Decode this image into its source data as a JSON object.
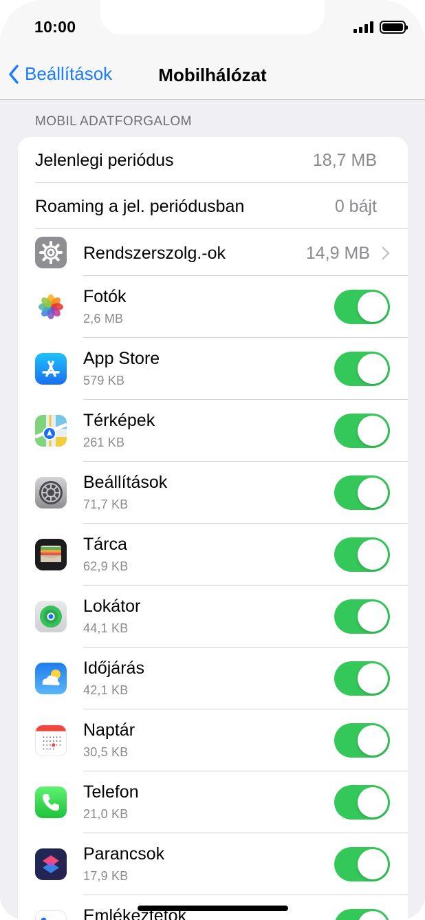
{
  "status_bar": {
    "time": "10:00"
  },
  "nav": {
    "back_label": "Beállítások",
    "title": "Mobilhálózat"
  },
  "section_header": "MOBIL ADATFORGALOM",
  "summary_rows": [
    {
      "label": "Jelenlegi periódus",
      "value": "18,7 MB"
    },
    {
      "label": "Roaming a jel. periódusban",
      "value": "0 bájt"
    }
  ],
  "system_services": {
    "label": "Rendszerszolg.-ok",
    "value": "14,9 MB",
    "icon": "gear-icon"
  },
  "apps": [
    {
      "name": "Fotók",
      "size": "2,6 MB",
      "icon": "photos-icon",
      "enabled": true
    },
    {
      "name": "App Store",
      "size": "579 KB",
      "icon": "app-store-icon",
      "enabled": true
    },
    {
      "name": "Térképek",
      "size": "261 KB",
      "icon": "maps-icon",
      "enabled": true
    },
    {
      "name": "Beállítások",
      "size": "71,7 KB",
      "icon": "settings-icon",
      "enabled": true
    },
    {
      "name": "Tárca",
      "size": "62,9 KB",
      "icon": "wallet-icon",
      "enabled": true
    },
    {
      "name": "Lokátor",
      "size": "44,1 KB",
      "icon": "find-my-icon",
      "enabled": true
    },
    {
      "name": "Időjárás",
      "size": "42,1 KB",
      "icon": "weather-icon",
      "enabled": true
    },
    {
      "name": "Naptár",
      "size": "30,5 KB",
      "icon": "calendar-icon",
      "enabled": true
    },
    {
      "name": "Telefon",
      "size": "21,0 KB",
      "icon": "phone-icon",
      "enabled": true
    },
    {
      "name": "Parancsok",
      "size": "17,9 KB",
      "icon": "shortcuts-icon",
      "enabled": true
    },
    {
      "name": "Emlékeztetők",
      "size": "",
      "icon": "reminders-icon",
      "enabled": true
    }
  ],
  "colors": {
    "accent": "#1a7cff",
    "toggle_on": "#34c759",
    "secondary_text": "#8a8a8e",
    "background": "#efeff4"
  }
}
